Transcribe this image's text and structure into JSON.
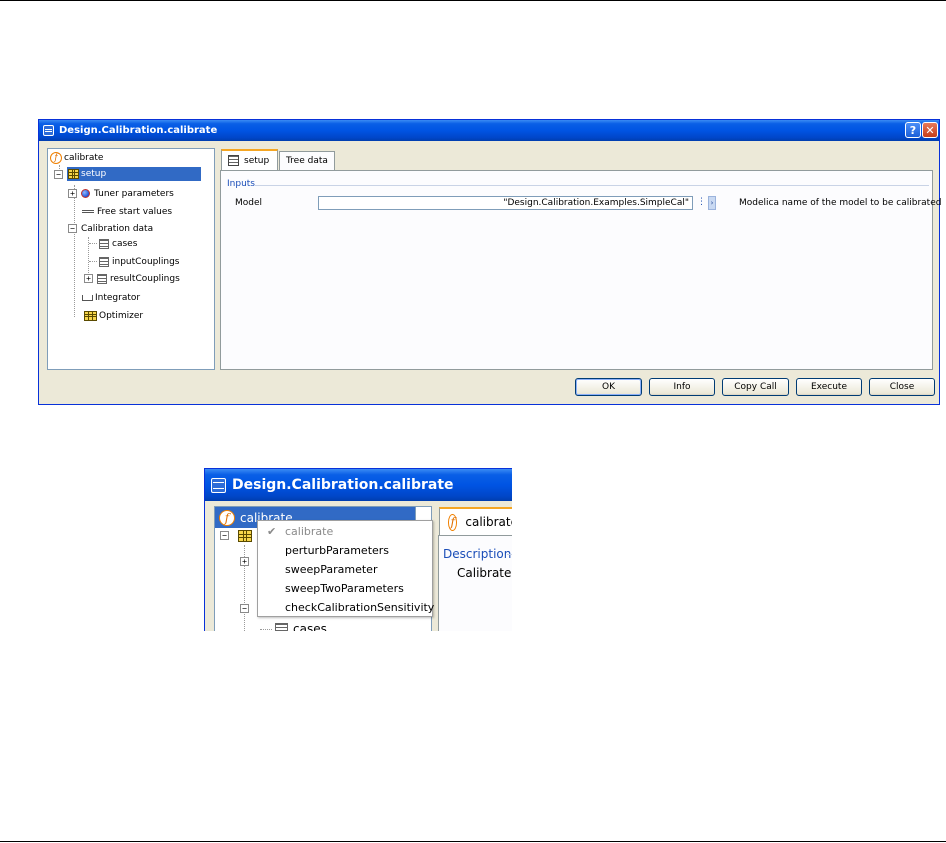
{
  "window": {
    "title": "Design.Calibration.calibrate",
    "help_glyph": "?",
    "close_glyph": "✕"
  },
  "tree": {
    "root": "calibrate",
    "setup": "setup",
    "tuner_parameters": "Tuner parameters",
    "free_start_values": "Free start values",
    "calibration_data": "Calibration data",
    "cases": "cases",
    "input_couplings": "inputCouplings",
    "result_couplings": "resultCouplings",
    "integrator": "Integrator",
    "optimizer": "Optimizer"
  },
  "tabs": {
    "setup": "setup",
    "tree_data": "Tree data"
  },
  "inputs": {
    "group_label": "Inputs",
    "model_label": "Model",
    "model_value": "\"Design.Calibration.Examples.SimpleCal\"",
    "model_description": "Modelica name of the model to be calibrated"
  },
  "buttons": {
    "ok": "OK",
    "info": "Info",
    "copy_call": "Copy Call",
    "execute": "Execute",
    "close": "Close"
  },
  "zoom": {
    "title": "Design.Calibration.calibrate",
    "tree_root": "calibrate",
    "tree_cases": "cases",
    "tab_label": "calibrate",
    "description_label": "Description",
    "description_text": "Calibrate m"
  },
  "menu": {
    "items": [
      {
        "label": "calibrate",
        "checked": true
      },
      {
        "label": "perturbParameters",
        "checked": false
      },
      {
        "label": "sweepParameter",
        "checked": false
      },
      {
        "label": "sweepTwoParameters",
        "checked": false
      },
      {
        "label": "checkCalibrationSensitivity",
        "checked": false
      }
    ],
    "check_glyph": "✔"
  },
  "colors": {
    "titlebar": "#0054e3",
    "selection": "#316ac5",
    "function_icon": "#f08000",
    "group_label": "#1a4db8"
  }
}
